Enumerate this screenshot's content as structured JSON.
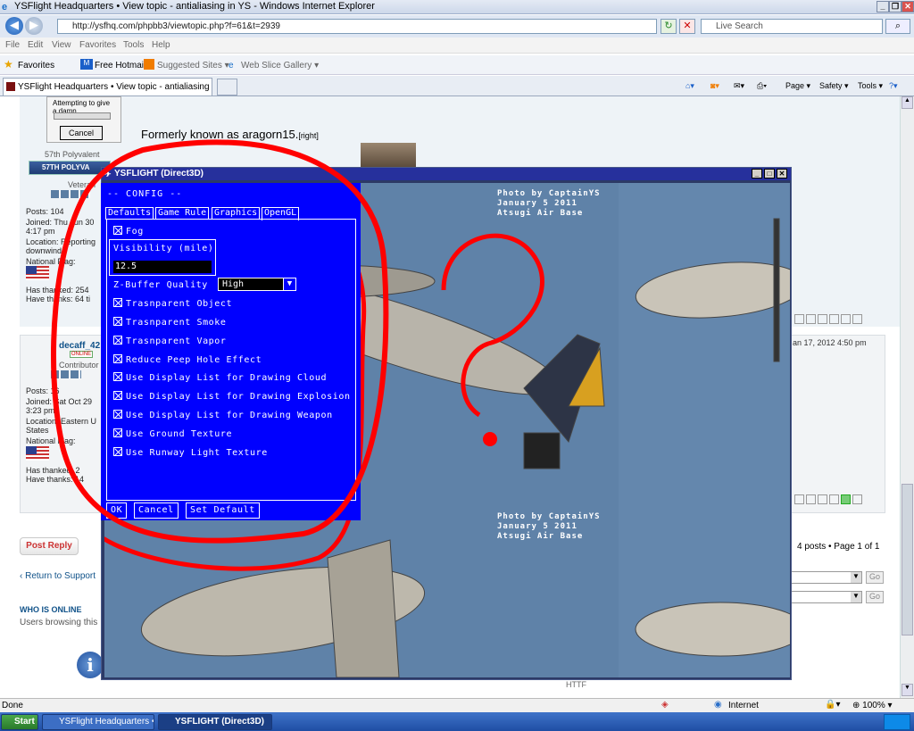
{
  "browser": {
    "title": "YSFlight Headquarters • View topic - antialiasing in YS - Windows Internet Explorer",
    "url": "http://ysfhq.com/phpbb3/viewtopic.php?f=61&t=2939",
    "search_placeholder": "Live Search",
    "menu": [
      "File",
      "Edit",
      "View",
      "Favorites",
      "Tools",
      "Help"
    ],
    "favorites_label": "Favorites",
    "fav_links": [
      "Free Hotmail",
      "Suggested Sites ▾",
      "Web Slice Gallery ▾"
    ],
    "tab_label": "YSFlight Headquarters • View topic - antialiasing in YS",
    "commands": [
      "Page ▾",
      "Safety ▾",
      "Tools ▾"
    ]
  },
  "page": {
    "popup_text": "Attempting to give a damn...",
    "popup_cancel": "Cancel",
    "formerly": "Formerly known as aragorn15.",
    "right_tag": "[right]",
    "user1": {
      "group": "57th Polyvalent",
      "badge": "57TH POLYVA",
      "rank": "Veteran",
      "posts": "Posts: 104",
      "joined": "Joined: Thu Jun 30",
      "joined_time": "4:17 pm",
      "location": "Location: Reporting",
      "location2": "downwind",
      "flag_label": "National Flag:",
      "thanked": "Has thanked: 254",
      "thanks": "Have thanks: 64 ti"
    },
    "user2": {
      "name": "decaff_42",
      "online": "ONLINE",
      "rank": "Contributor",
      "posts": "Posts: 16",
      "joined": "Joined: Sat Oct 29",
      "joined_time": "3:23 pm",
      "location": "Location: Eastern U",
      "location2": "States",
      "flag_label": "National Flag:",
      "thanked": "Has thanked: 2",
      "thanks": "Have thanks: 14"
    },
    "post_date": "an 17, 2012 4:50 pm",
    "post_reply": "Post Reply",
    "posts_count": "4 posts • Page 1 of 1",
    "return_link": "Return to Support",
    "who_online": "WHO IS ONLINE",
    "users_browsing": "Users browsing this",
    "go": "Go",
    "http_label": "HTTF"
  },
  "game_window": {
    "title": "YSFLIGHT (Direct3D)",
    "photo_credit": [
      "Photo by CaptainYS",
      "January 5 2011",
      "Atsugi Air Base"
    ]
  },
  "config": {
    "header": "-- CONFIG --",
    "tabs": [
      "Defaults",
      "Game Rule",
      "Graphics",
      "OpenGL"
    ],
    "fog": "Fog",
    "visibility_label": "Visibility (mile)",
    "visibility_value": "12.5",
    "zbuffer_label": "Z-Buffer Quality",
    "zbuffer_value": "High",
    "options": [
      "Trasnparent Object",
      "Trasnparent Smoke",
      "Trasnparent Vapor",
      "Reduce Peep Hole Effect",
      "Use Display List for Drawing Cloud",
      "Use Display List for Drawing Explosion",
      "Use Display List for Drawing Weapon",
      "Use Ground Texture",
      "Use Runway Light Texture"
    ],
    "buttons": [
      "OK",
      "Cancel",
      "Set Default"
    ]
  },
  "status": {
    "left": "Done",
    "zone": "Internet",
    "zoom": "100%"
  },
  "taskbar": {
    "start": "Start",
    "items": [
      "YSFlight Headquarters • ...",
      "YSFLIGHT (Direct3D)"
    ]
  }
}
